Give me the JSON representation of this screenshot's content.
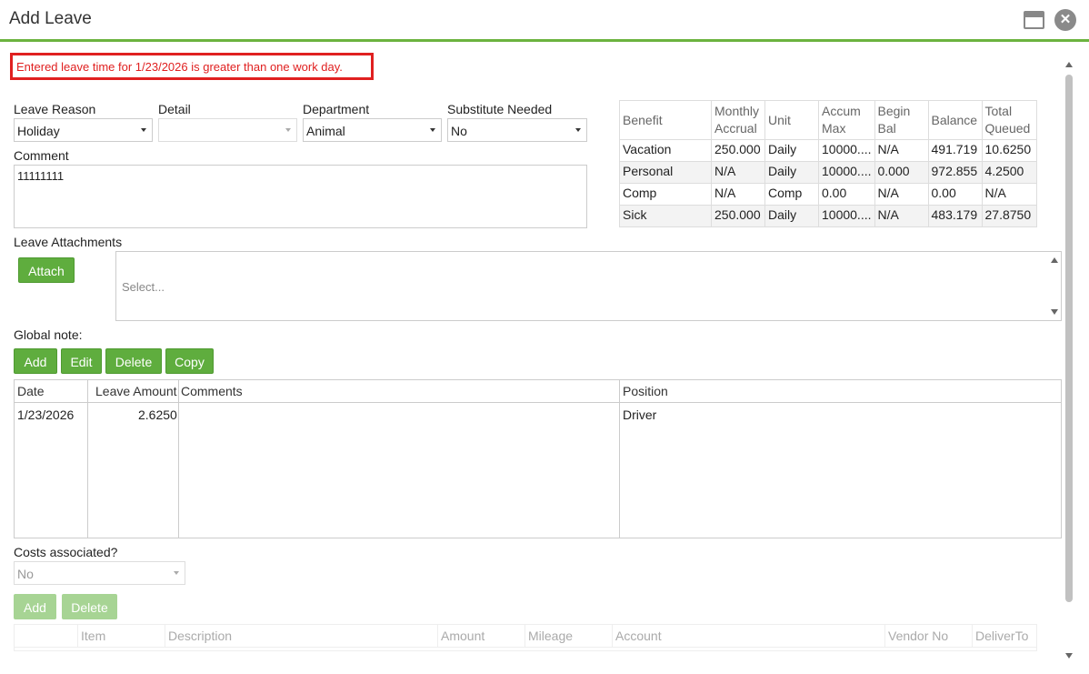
{
  "window": {
    "title": "Add Leave"
  },
  "error": {
    "message": "Entered leave time for 1/23/2026 is greater than one work day."
  },
  "form": {
    "leave_reason": {
      "label": "Leave Reason",
      "value": "Holiday"
    },
    "detail": {
      "label": "Detail",
      "value": ""
    },
    "department": {
      "label": "Department",
      "value": "Animal"
    },
    "substitute": {
      "label": "Substitute Needed",
      "value": "No"
    },
    "comment": {
      "label": "Comment",
      "value": "11111111"
    }
  },
  "benefits": {
    "headers": [
      "Benefit",
      "Monthly Accrual",
      "Unit",
      "Accum Max",
      "Begin Bal",
      "Balance",
      "Total Queued"
    ],
    "rows": [
      [
        "Vacation",
        "250.000",
        "Daily",
        "10000....",
        "N/A",
        "491.719",
        "10.6250"
      ],
      [
        "Personal",
        "N/A",
        "Daily",
        "10000....",
        "0.000",
        "972.855",
        "4.2500"
      ],
      [
        "Comp",
        "N/A",
        "Comp",
        "0.00",
        "N/A",
        "0.00",
        "N/A"
      ],
      [
        "Sick",
        "250.000",
        "Daily",
        "10000....",
        "N/A",
        "483.179",
        "27.8750"
      ]
    ]
  },
  "attachments": {
    "label": "Leave Attachments",
    "attach_button": "Attach",
    "placeholder": "Select..."
  },
  "global_note": {
    "label": "Global note:",
    "buttons": {
      "add": "Add",
      "edit": "Edit",
      "delete": "Delete",
      "copy": "Copy"
    }
  },
  "leave_grid": {
    "headers": {
      "date": "Date",
      "amount": "Leave Amount",
      "comments": "Comments",
      "position": "Position"
    },
    "rows": [
      {
        "date": "1/23/2026",
        "amount": "2.6250",
        "comments": "",
        "position": "Driver"
      }
    ]
  },
  "costs": {
    "label": "Costs associated?",
    "value": "No",
    "buttons": {
      "add": "Add",
      "delete": "Delete"
    },
    "headers": {
      "item": "Item",
      "description": "Description",
      "amount": "Amount",
      "mileage": "Mileage",
      "account": "Account",
      "vendor": "Vendor No",
      "deliver": "DeliverTo"
    }
  },
  "colors": {
    "accent_green": "#5fad3e",
    "error_red": "#e02020",
    "title_line": "#6cb33f"
  }
}
